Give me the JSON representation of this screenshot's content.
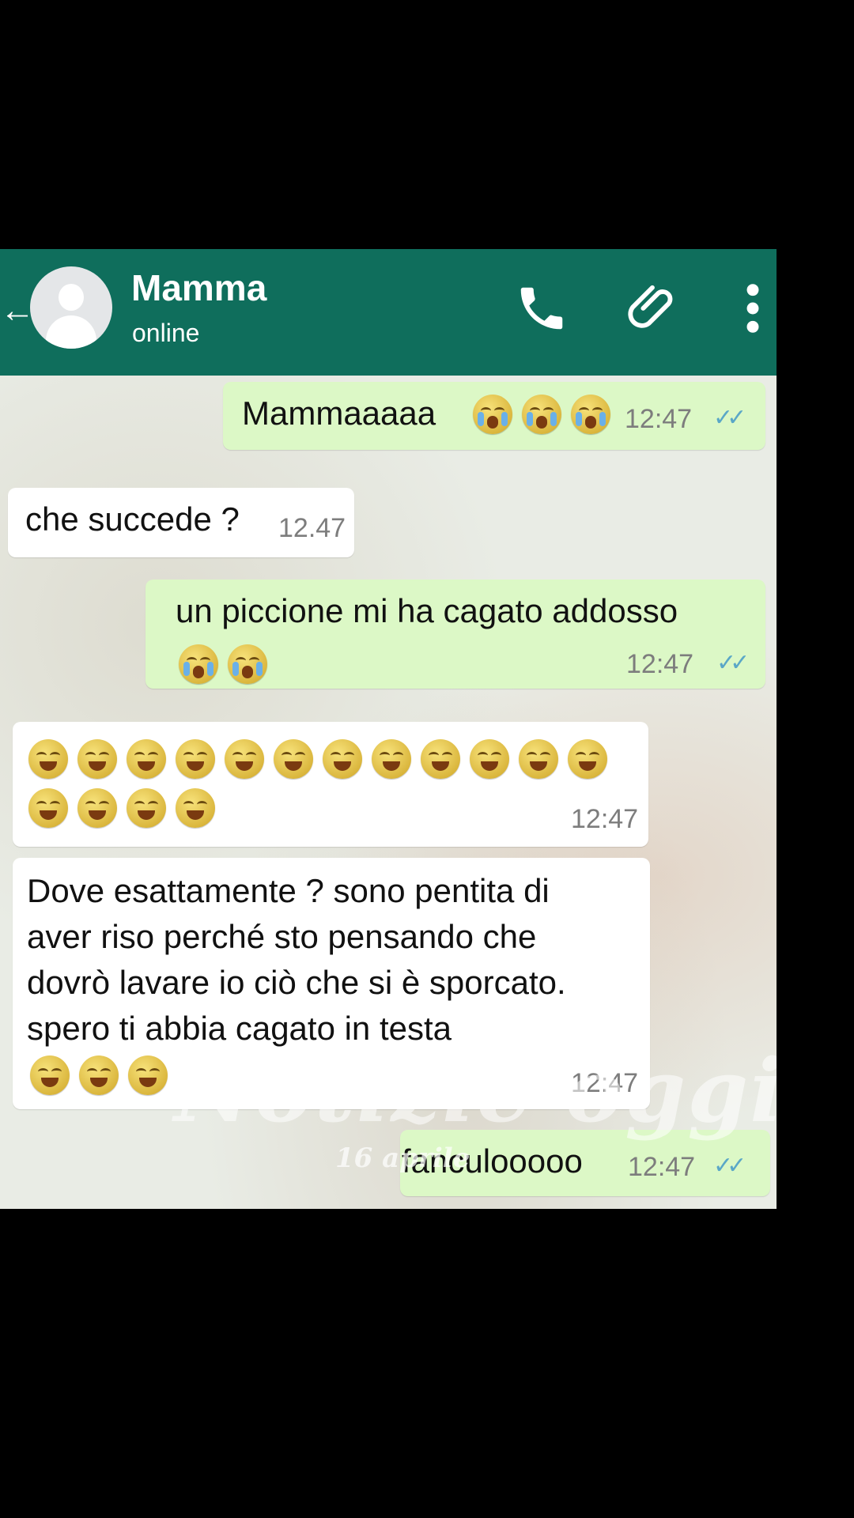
{
  "header": {
    "contact_name": "Mamma",
    "status": "online",
    "back_icon": "back-arrow-icon",
    "icons": [
      "phone-icon",
      "paperclip-icon",
      "more-vert-icon"
    ],
    "bar_color": "#0f6e5c"
  },
  "messages": [
    {
      "direction": "outgoing",
      "text": "Mammaaaaa",
      "emojis": [
        "loudly-crying-face",
        "loudly-crying-face",
        "loudly-crying-face"
      ],
      "time": "12:47",
      "ticks": "✓✓"
    },
    {
      "direction": "incoming",
      "text": "che succede ?",
      "time": "12.47"
    },
    {
      "direction": "outgoing",
      "text": "un piccione mi ha cagato addosso",
      "emojis": [
        "loudly-crying-face",
        "loudly-crying-face"
      ],
      "time": "12:47",
      "ticks": "✓✓"
    },
    {
      "direction": "incoming",
      "text": "",
      "emoji_count": 16,
      "emoji": "face-with-tears-of-joy",
      "time": "12:47"
    },
    {
      "direction": "incoming",
      "lines": [
        "Dove esattamente ? sono pentita di",
        "aver riso perché sto pensando che",
        "dovrò lavare io ciò che si è sporcato.",
        "spero ti abbia cagato in testa"
      ],
      "emojis": [
        "face-with-tears-of-joy",
        "face-with-tears-of-joy",
        "face-with-tears-of-joy"
      ],
      "time": "12:47"
    },
    {
      "direction": "outgoing",
      "text": "fanculooooo",
      "time": "12:47",
      "ticks": "✓✓"
    }
  ],
  "watermark": {
    "text": "Notizie oggi",
    "date": "16 aprile"
  },
  "colors": {
    "outgoing_bubble": "#dcf8c6",
    "incoming_bubble": "#ffffff",
    "tick_blue": "#5aa7c7"
  }
}
